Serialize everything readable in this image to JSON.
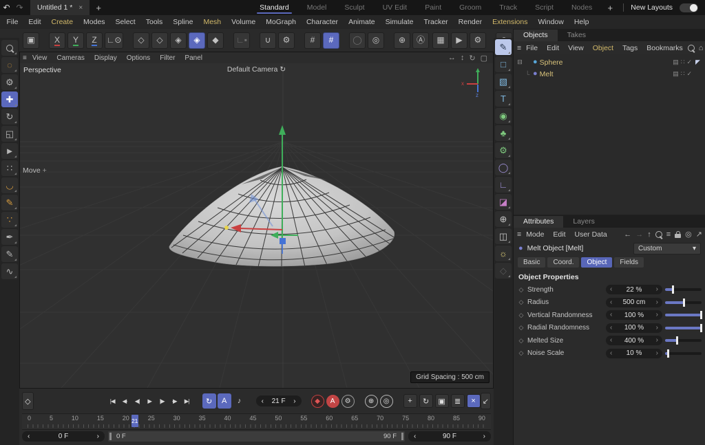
{
  "glyphs": {
    "prev": "‹",
    "next": "›",
    "dropdown": "▾",
    "hamburger": "≡",
    "undo": "↶",
    "redo": "↷",
    "close": "×",
    "plus": "+"
  },
  "colors": {
    "accent": "#5b69bd",
    "gold": "#d2b96a",
    "axis_x": "#c94040",
    "axis_y": "#3fae5a",
    "axis_z": "#4473d6",
    "slider_fill": "#6b78c4",
    "record_red": "#c24545"
  },
  "titlebar": {
    "document_tab": "Untitled 1 *",
    "layouts": [
      {
        "label": "Standard",
        "active": true
      },
      {
        "label": "Model"
      },
      {
        "label": "Sculpt"
      },
      {
        "label": "UV Edit"
      },
      {
        "label": "Paint"
      },
      {
        "label": "Groom"
      },
      {
        "label": "Track"
      },
      {
        "label": "Script"
      },
      {
        "label": "Nodes"
      }
    ],
    "new_layouts": "New Layouts"
  },
  "menubar": {
    "items": [
      {
        "label": "File"
      },
      {
        "label": "Edit"
      },
      {
        "label": "Create",
        "accent": true
      },
      {
        "label": "Modes"
      },
      {
        "label": "Select"
      },
      {
        "label": "Tools"
      },
      {
        "label": "Spline"
      },
      {
        "label": "Mesh",
        "accent": true
      },
      {
        "label": "Volume"
      },
      {
        "label": "MoGraph"
      },
      {
        "label": "Character"
      },
      {
        "label": "Animate"
      },
      {
        "label": "Simulate"
      },
      {
        "label": "Tracker"
      },
      {
        "label": "Render"
      },
      {
        "label": "Extensions",
        "accent": true
      },
      {
        "label": "Window"
      },
      {
        "label": "Help"
      }
    ]
  },
  "toolbar": {
    "items": [
      {
        "name": "make-editable-button",
        "glyph": "▣"
      },
      {
        "gap": true,
        "name": "lock-x-axis-button",
        "glyph": "X",
        "underline": "#c94040"
      },
      {
        "name": "lock-y-axis-button",
        "glyph": "Y",
        "underline": "#3fae5a"
      },
      {
        "name": "lock-z-axis-button",
        "glyph": "Z",
        "underline": "#4473d6"
      },
      {
        "name": "coordinate-system-button",
        "glyph": "∟⊙"
      },
      {
        "gap": true,
        "name": "points-mode-button",
        "glyph": "◇"
      },
      {
        "name": "edges-mode-button",
        "glyph": "◇"
      },
      {
        "name": "polygons-mode-button",
        "glyph": "◈"
      },
      {
        "name": "model-mode-button",
        "glyph": "◈",
        "active": true
      },
      {
        "name": "texture-mode-button",
        "glyph": "◆"
      },
      {
        "gap": true,
        "name": "workplane-mode-button",
        "glyph": "∟▪",
        "dim": true
      },
      {
        "gap": true,
        "name": "snap-magnet-button",
        "glyph": "∪"
      },
      {
        "name": "snap-settings-button",
        "glyph": "⚙"
      },
      {
        "gap": true,
        "name": "workplane-grid-button",
        "glyph": "#"
      },
      {
        "name": "quantize-grid-button",
        "glyph": "#",
        "active": true
      },
      {
        "gap": true,
        "name": "axis-modify-button",
        "glyph": "◯",
        "dim": true
      },
      {
        "name": "axis-center-button",
        "glyph": "◎"
      },
      {
        "gap": true,
        "name": "snap-3d-button",
        "glyph": "⊕"
      },
      {
        "name": "auto-snap-button",
        "glyph": "Ⓐ"
      }
    ],
    "render_items": [
      {
        "name": "render-view-button",
        "glyph": "▦"
      },
      {
        "name": "render-picture-viewer-button",
        "glyph": "▶"
      },
      {
        "name": "render-settings-button",
        "glyph": "⚙"
      },
      {
        "gap": true,
        "name": "material-manager-button",
        "glyph": "◉"
      }
    ]
  },
  "left_tools": {
    "items": [
      {
        "name": "find-tool-button",
        "cls": "i-search"
      },
      {
        "gap": true,
        "name": "live-selection-button",
        "glyph": "◌",
        "fg": "#d79c3f"
      },
      {
        "name": "tweak-selection-button",
        "glyph": "⚙"
      },
      {
        "gap": true,
        "name": "move-tool-button",
        "glyph": "✚",
        "active": true
      },
      {
        "name": "rotate-tool-button",
        "glyph": "↻"
      },
      {
        "name": "scale-tool-button",
        "glyph": "◱"
      },
      {
        "gap": true,
        "name": "selection-move-button",
        "glyph": "►"
      },
      {
        "name": "omni-move-button",
        "glyph": "∷"
      },
      {
        "gap": true,
        "name": "smear-tool-button",
        "glyph": "◡",
        "fg": "#d79c3f"
      },
      {
        "name": "spline-pen-tool-button",
        "glyph": "✎",
        "fg": "#d79c3f"
      },
      {
        "name": "blob-tool-button",
        "glyph": "∵",
        "fg": "#d79c3f"
      },
      {
        "gap": true,
        "name": "brush-tool-button",
        "glyph": "✒"
      },
      {
        "name": "sketch-tool-button",
        "glyph": "✎"
      },
      {
        "name": "spline-smooth-button",
        "glyph": "∿"
      }
    ]
  },
  "viewport": {
    "menu": [
      "View",
      "Cameras",
      "Display",
      "Options",
      "Filter",
      "Panel"
    ],
    "nav_icons": [
      {
        "name": "pan-icon",
        "glyph": "↔"
      },
      {
        "name": "dolly-icon",
        "glyph": "↕"
      },
      {
        "name": "orbit-icon",
        "glyph": "↻"
      },
      {
        "name": "maximize-icon",
        "glyph": "▢"
      }
    ],
    "view_label": "Perspective",
    "camera_label": "Default Camera",
    "camera_icon": "↻",
    "tool_hint": "Move",
    "tool_hint_icon": "+",
    "grid_spacing": "Grid Spacing : 500 cm",
    "axis_x_label": "x",
    "axis_z_label": "z"
  },
  "palette": {
    "items": [
      {
        "name": "spline-pen-button",
        "glyph": "✎",
        "fg": "#28364e",
        "lit": true
      },
      {
        "gap": true,
        "name": "spline-primitive-button",
        "glyph": "□",
        "fg": "#7fb8e0"
      },
      {
        "name": "primitive-object-button",
        "glyph": "▧",
        "fg": "#7fb8e0"
      },
      {
        "name": "motext-button",
        "glyph": "T",
        "fg": "#7fb8e0"
      },
      {
        "gap": true,
        "name": "subdivision-surface-button",
        "glyph": "◉",
        "fg": "#7ec97e"
      },
      {
        "name": "generator-button",
        "glyph": "♣",
        "fg": "#7ec97e"
      },
      {
        "name": "deformer-button",
        "glyph": "⚙",
        "fg": "#7ec97e"
      },
      {
        "gap": true,
        "name": "field-button",
        "glyph": "◯",
        "fg": "#a090d8"
      },
      {
        "name": "workplane-object-button",
        "glyph": "∟",
        "fg": "#a090d8"
      },
      {
        "gap": true,
        "name": "xpresso-button",
        "glyph": "◪",
        "fg": "#c77fc7"
      },
      {
        "gap": true,
        "name": "environment-button",
        "glyph": "⊕",
        "fg": "#c9c9c9"
      },
      {
        "name": "camera-button",
        "glyph": "◫",
        "fg": "#c9c9c9"
      },
      {
        "name": "light-button",
        "glyph": "☼",
        "fg": "#e2d27a"
      },
      {
        "gap": true,
        "name": "volume-disabled-button",
        "glyph": "◇",
        "fg": "#585858"
      }
    ]
  },
  "object_manager": {
    "tabs": [
      {
        "label": "Objects",
        "active": true
      },
      {
        "label": "Takes"
      }
    ],
    "menu": [
      {
        "label": "File"
      },
      {
        "label": "Edit"
      },
      {
        "label": "View"
      },
      {
        "label": "Object",
        "accent": true
      },
      {
        "label": "Tags"
      },
      {
        "label": "Bookmarks"
      }
    ],
    "icons": [
      {
        "name": "search-icon",
        "cls": "i-search"
      },
      {
        "name": "home-icon",
        "glyph": "⌂"
      },
      {
        "name": "filter-icon",
        "glyph": "≡"
      },
      {
        "name": "external-window-icon",
        "glyph": "↗"
      }
    ],
    "tree": [
      {
        "expander": "⊟",
        "branch": "",
        "name": "Sphere",
        "icon_color": "#58a6d8",
        "stack": "▤",
        "dots": "∷",
        "check": "✓",
        "tag": "◤"
      },
      {
        "expander": "",
        "branch": "└",
        "name": "Melt",
        "icon_color": "#7a7fd0",
        "stack": "▤",
        "dots": "∷",
        "check": "✓",
        "tag": ""
      }
    ]
  },
  "attributes": {
    "tabs": [
      {
        "label": "Attributes",
        "active": true
      },
      {
        "label": "Layers"
      }
    ],
    "menu": [
      {
        "label": "Mode"
      },
      {
        "label": "Edit"
      },
      {
        "label": "User Data"
      }
    ],
    "icons": [
      {
        "name": "back-icon",
        "glyph": "←"
      },
      {
        "name": "forward-icon",
        "glyph": "→",
        "dim": true
      },
      {
        "name": "up-icon",
        "glyph": "↑"
      },
      {
        "name": "search-icon",
        "cls": "i-search"
      },
      {
        "name": "filter-icon",
        "glyph": "≡"
      },
      {
        "name": "lock-icon",
        "cls": "i-lock"
      },
      {
        "name": "target-icon",
        "glyph": "◎"
      },
      {
        "name": "external-window-icon",
        "glyph": "↗"
      }
    ],
    "object_title": "Melt Object [Melt]",
    "object_icon": "●",
    "preset": "Custom",
    "section_tabs": [
      {
        "label": "Basic"
      },
      {
        "label": "Coord."
      },
      {
        "label": "Object",
        "active": true
      },
      {
        "label": "Fields"
      }
    ],
    "group_title": "Object Properties",
    "properties": [
      {
        "label": "Strength",
        "value": "22 %",
        "fill": 23
      },
      {
        "label": "Radius",
        "value": "500 cm",
        "fill": 52
      },
      {
        "label": "Vertical Randomness",
        "value": "100 %",
        "fill": 100
      },
      {
        "label": "Radial Randomness",
        "value": "100 %",
        "fill": 100
      },
      {
        "label": "Melted Size",
        "value": "400 %",
        "fill": 34
      },
      {
        "label": "Noise Scale",
        "value": "10 %",
        "fill": 10
      }
    ]
  },
  "timeline": {
    "keyframe_button": "◇",
    "transport": [
      {
        "name": "goto-start-button",
        "glyph": "|◀"
      },
      {
        "name": "prev-key-button",
        "glyph": "◀∙"
      },
      {
        "name": "prev-frame-button",
        "glyph": "◀|"
      },
      {
        "name": "play-button",
        "glyph": "▶"
      },
      {
        "name": "next-frame-button",
        "glyph": "|▶"
      },
      {
        "name": "next-key-button",
        "glyph": "∙▶"
      },
      {
        "name": "goto-end-button",
        "glyph": "▶|"
      }
    ],
    "toggles": [
      {
        "name": "loop-playback-button",
        "glyph": "↻",
        "active": true
      },
      {
        "name": "play-mode-button",
        "glyph": "A",
        "active": true
      },
      {
        "name": "play-sound-button",
        "glyph": "♪"
      }
    ],
    "frame_value": "21 F",
    "records": [
      {
        "name": "record-keyframe-button",
        "glyph": "◆",
        "bg": "#362222",
        "fg": "#e05656",
        "bd": "#c04040"
      },
      {
        "name": "autokeying-button",
        "glyph": "A",
        "bg": "#c24545",
        "fg": "#ffffff",
        "bd": "#c24545"
      },
      {
        "name": "keyframe-selection-button",
        "glyph": "⚙",
        "bg": "#2e2e2e",
        "fg": "#d5d5d5",
        "bd": "#9a9a9a"
      },
      {
        "gap": true,
        "name": "record-position-button",
        "glyph": "⊕",
        "bg": "#2e2e2e",
        "fg": "#e0e0e0",
        "bd": "#b5b5b5"
      },
      {
        "name": "record-rotation-button",
        "glyph": "◎",
        "bg": "#2e2e2e",
        "fg": "#e0e0e0",
        "bd": "#b5b5b5"
      },
      {
        "gap": true,
        "name": "position-track-button",
        "glyph": "+",
        "sq": true
      },
      {
        "name": "rotation-track-button",
        "glyph": "↻",
        "sq": true
      },
      {
        "name": "scale-track-button",
        "glyph": "▣",
        "sq": true
      },
      {
        "name": "pla-track-button",
        "glyph": "≣",
        "sq": true
      },
      {
        "name": "snap-keys-button",
        "glyph": "×",
        "sq": true,
        "bg": "#5b69bd",
        "fg": "#ffffff"
      }
    ],
    "dopesheet_icon": "↙",
    "ticks": [
      "0",
      "5",
      "10",
      "15",
      "20",
      "25",
      "30",
      "35",
      "40",
      "45",
      "50",
      "55",
      "60",
      "65",
      "70",
      "75",
      "80",
      "85",
      "90"
    ],
    "playhead_label": "21",
    "playhead_pct": 23.3,
    "range_start_value": "0 F",
    "range_end_value": "90 F",
    "range_bar_start": "0 F",
    "range_bar_end": "90 F"
  }
}
